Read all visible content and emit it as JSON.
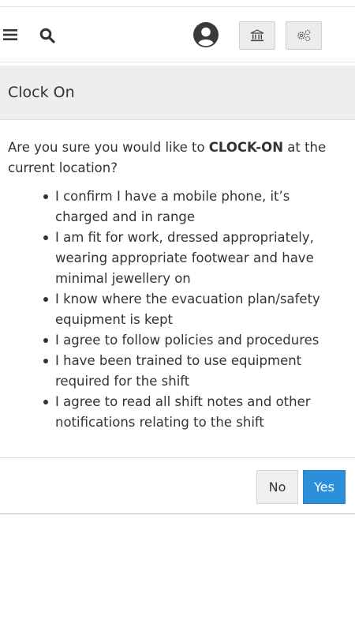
{
  "header": {
    "icons": {
      "menu": "hamburger-icon",
      "search": "search-icon",
      "user": "user-circle-icon",
      "bank": "bank-icon",
      "settings": "gears-icon"
    }
  },
  "dialog": {
    "title": "Clock On",
    "intro_prefix": "Are you sure you would like to ",
    "intro_bold": "CLOCK-ON",
    "intro_suffix": " at the current location?",
    "bullets": [
      "I confirm I have a mobile phone, it’s charged and in range",
      "I am fit for work, dressed appropriately, wearing appropriate footwear and have minimal jewellery on",
      "I know where the evacuation plan/safety equipment is kept",
      "I agree to follow policies and procedures",
      "I have been trained to use equipment required for the shift",
      "I agree to read all shift notes and other notifications relating to the shift"
    ],
    "no_label": "No",
    "yes_label": "Yes"
  },
  "colors": {
    "primary": "#2b8fd9",
    "header_bg": "#eeeeee",
    "text": "#333333"
  }
}
